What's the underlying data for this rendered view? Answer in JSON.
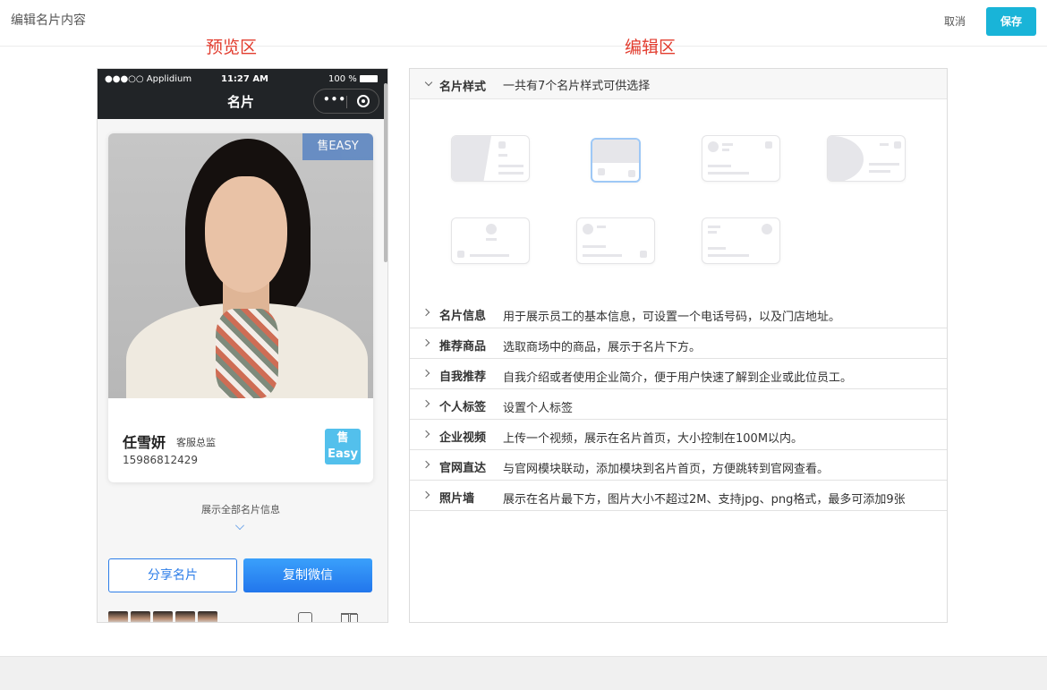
{
  "header": {
    "title": "编辑名片内容",
    "cancel_label": "取消",
    "save_label": "保存",
    "accent": "#19b4d8"
  },
  "regions": {
    "preview": "预览区",
    "editor": "编辑区"
  },
  "phone": {
    "carrier": "●●●○○ Applidium",
    "time": "11:27 AM",
    "battery": "100 %",
    "nav_title": "名片",
    "badge": "售EASY",
    "name": "任雪妍",
    "position": "客服总监",
    "tel": "15986812429",
    "logo_top": "售",
    "logo_bottom": "Easy",
    "show_all": "展示全部名片信息",
    "share_label": "分享名片",
    "copy_label": "复制微信"
  },
  "editor": {
    "style_section": {
      "title": "名片样式",
      "desc": "一共有7个名片样式可供选择"
    },
    "sections": [
      {
        "title": "名片信息",
        "desc": "用于展示员工的基本信息，可设置一个电话号码，以及门店地址。"
      },
      {
        "title": "推荐商品",
        "desc": "选取商场中的商品，展示于名片下方。"
      },
      {
        "title": "自我推荐",
        "desc": "自我介绍或者使用企业简介，便于用户快速了解到企业或此位员工。"
      },
      {
        "title": "个人标签",
        "desc": "设置个人标签"
      },
      {
        "title": "企业视频",
        "desc": "上传一个视频，展示在名片首页，大小控制在100M以内。"
      },
      {
        "title": "官网直达",
        "desc": "与官网模块联动，添加模块到名片首页，方便跳转到官网查看。"
      },
      {
        "title": "照片墙",
        "desc": "展示在名片最下方，图片大小不超过2M、支持jpg、png格式，最多可添加9张"
      }
    ]
  }
}
